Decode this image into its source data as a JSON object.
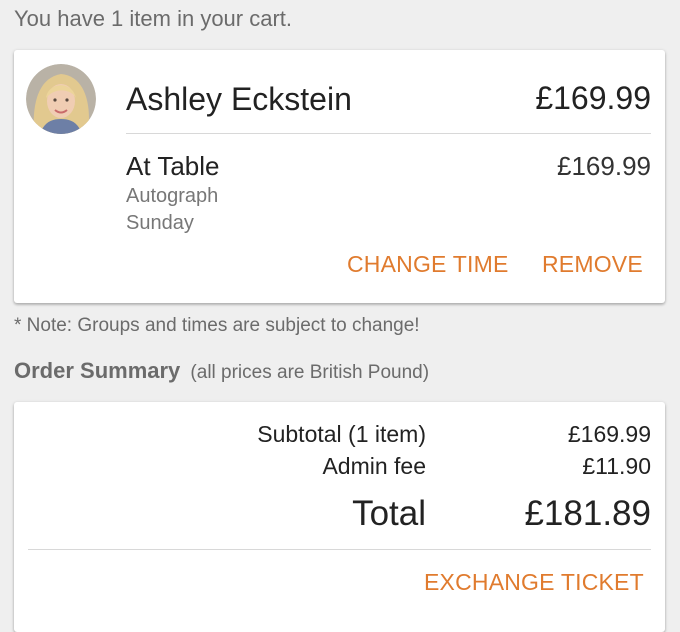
{
  "header": {
    "cart_count_text": "You have 1 item in your cart."
  },
  "item": {
    "guest_name": "Ashley Eckstein",
    "guest_total": "£169.99",
    "type": "At Table",
    "type_price": "£169.99",
    "category": "Autograph",
    "day": "Sunday",
    "change_time_label": "CHANGE TIME",
    "remove_label": "REMOVE",
    "avatar_icon": "guest-photo-avatar"
  },
  "note": "* Note: Groups and times are subject to change!",
  "summary": {
    "title": "Order Summary",
    "subtitle": "(all prices are British Pound)",
    "subtotal_label": "Subtotal (1 item)",
    "subtotal_value": "£169.99",
    "fee_label": "Admin fee",
    "fee_value": "£11.90",
    "total_label": "Total",
    "total_value": "£181.89",
    "exchange_label": "EXCHANGE TICKET"
  },
  "colors": {
    "accent": "#e07b2e",
    "background": "#efefef",
    "card": "#ffffff"
  }
}
